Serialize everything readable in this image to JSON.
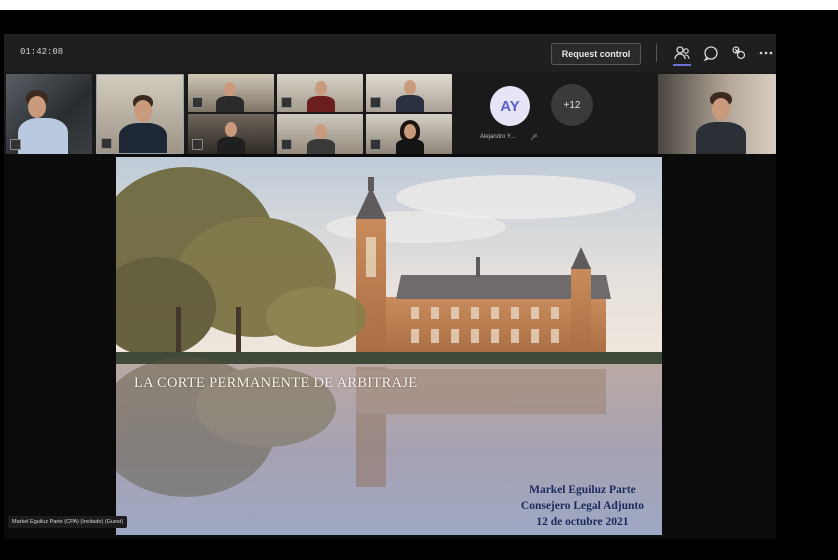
{
  "meeting": {
    "timer": "01:42:08",
    "request_control_label": "Request control"
  },
  "toolbar": {
    "icons": [
      "people-icon",
      "chat-icon",
      "reactions-icon",
      "more-options-icon"
    ],
    "active_color": "#6b6fd8"
  },
  "participants": {
    "avatar_initials": "AY",
    "avatar_name": "Alejandro Y...",
    "overflow_count": "+12"
  },
  "slide": {
    "title": "LA CORTE PERMANENTE DE ARBITRAJE",
    "presenter_name": "Markel Eguiluz Parte",
    "presenter_role": "Consejero Legal Adjunto",
    "date": "12 de octubre 2021"
  },
  "caption": {
    "presenter_label": "Markel Eguiluz Parte (CPA) (Invitado) (Guest)"
  }
}
